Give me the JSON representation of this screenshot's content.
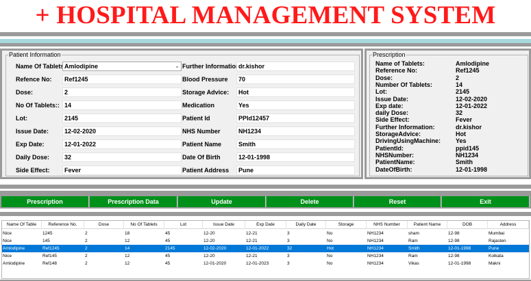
{
  "title": "+ HOSPITAL MANAGEMENT SYSTEM",
  "patient_info": {
    "legend": "Patient Information",
    "fields_left": [
      {
        "label": "Name Of Tablets",
        "value": "Amlodipine",
        "type": "combo"
      },
      {
        "label": "Refence No:",
        "value": "Ref1245"
      },
      {
        "label": "Dose:",
        "value": "2"
      },
      {
        "label": "No Of Tablets::",
        "value": "14"
      },
      {
        "label": "Lot:",
        "value": "2145"
      },
      {
        "label": "Issue Date:",
        "value": "12-02-2020"
      },
      {
        "label": "Exp Date:",
        "value": "12-01-2022"
      },
      {
        "label": "Daily Dose:",
        "value": "32"
      },
      {
        "label": "Side Effect:",
        "value": "Fever"
      }
    ],
    "fields_right": [
      {
        "label": "Further Information",
        "value": "dr.kishor"
      },
      {
        "label": "Blood Pressure",
        "value": "70"
      },
      {
        "label": "Storage Advice:",
        "value": "Hot"
      },
      {
        "label": "Medication",
        "value": "Yes"
      },
      {
        "label": "Patient Id",
        "value": "PPId12457"
      },
      {
        "label": "NHS Number",
        "value": "NH1234"
      },
      {
        "label": "Patient Name",
        "value": "Smith"
      },
      {
        "label": "Date Of Birth",
        "value": "12-01-1998"
      },
      {
        "label": "Patient Address",
        "value": "Pune"
      }
    ]
  },
  "prescription": {
    "legend": "Prescription",
    "rows": [
      {
        "k": "Name of Tablets:",
        "v": "Amlodipine"
      },
      {
        "k": "Reference No:",
        "v": "Ref1245"
      },
      {
        "k": "Dose:",
        "v": "2"
      },
      {
        "k": "Number Of Tablets:",
        "v": "14"
      },
      {
        "k": "Lot:",
        "v": "2145"
      },
      {
        "k": "Issue Date:",
        "v": "12-02-2020"
      },
      {
        "k": "Exp date:",
        "v": "12-01-2022"
      },
      {
        "k": "daily Dose:",
        "v": "32"
      },
      {
        "k": "Side Effect:",
        "v": "Fever"
      },
      {
        "k": "Further Information:",
        "v": "dr.kishor"
      },
      {
        "k": "StorageAdvice:",
        "v": "Hot"
      },
      {
        "k": "DrivingUsingMachine:",
        "v": "Yes"
      },
      {
        "k": " PatientId:",
        "v": "ppid145"
      },
      {
        "k": "NHSNumber:",
        "v": "NH1234"
      },
      {
        "k": "PatientName:",
        "v": "Smith"
      },
      {
        "k": "DateOfBirth:",
        "v": "12-01-1998"
      }
    ]
  },
  "buttons": [
    "Prescription",
    "Prescription Data",
    "Update",
    "Delete",
    "Reset",
    "Exit"
  ],
  "colors": {
    "title": "#ff1a1a",
    "button": "#00911b",
    "selected_row": "#0078d7"
  },
  "table": {
    "columns": [
      "Name Of Table",
      "Reference No.",
      "Dose",
      "No Of Tablets",
      "Lot",
      "Issue Date",
      "Exp Date",
      "Daily Date",
      "Storage",
      "NHS Number",
      "Patient Name",
      "DOB",
      "Address"
    ],
    "rows": [
      [
        "Nice",
        "1245",
        "2",
        "18",
        "45",
        "12-20",
        "12-21",
        "3",
        "No",
        "NH1234",
        "sham",
        "12-98",
        "Mumbai"
      ],
      [
        "Nice",
        "145",
        "2",
        "12",
        "45",
        "12-20",
        "12-21",
        "3",
        "No",
        "NH1234",
        "Ram",
        "12-98",
        "Rajasten"
      ],
      [
        "Amlodipine",
        "Ref1245",
        "2",
        "14",
        "2145",
        "12-02-2020",
        "12-01-2022",
        "32",
        "Hot",
        "NH1234",
        "Smith",
        "12-01-1998",
        "Pune"
      ],
      [
        "Nice",
        "Ref145",
        "2",
        "12",
        "45",
        "12-20",
        "12-21",
        "3",
        "No",
        "NH1234",
        "Ram",
        "12-98",
        "Kolkata"
      ],
      [
        "Amlodipine",
        "Ref148",
        "2",
        "12",
        "45",
        "12-01-2020",
        "12-01-2023",
        "3",
        "No",
        "NH1234",
        "Vikas",
        "12-01-1998",
        "Makni"
      ]
    ],
    "selected_index": 2
  }
}
